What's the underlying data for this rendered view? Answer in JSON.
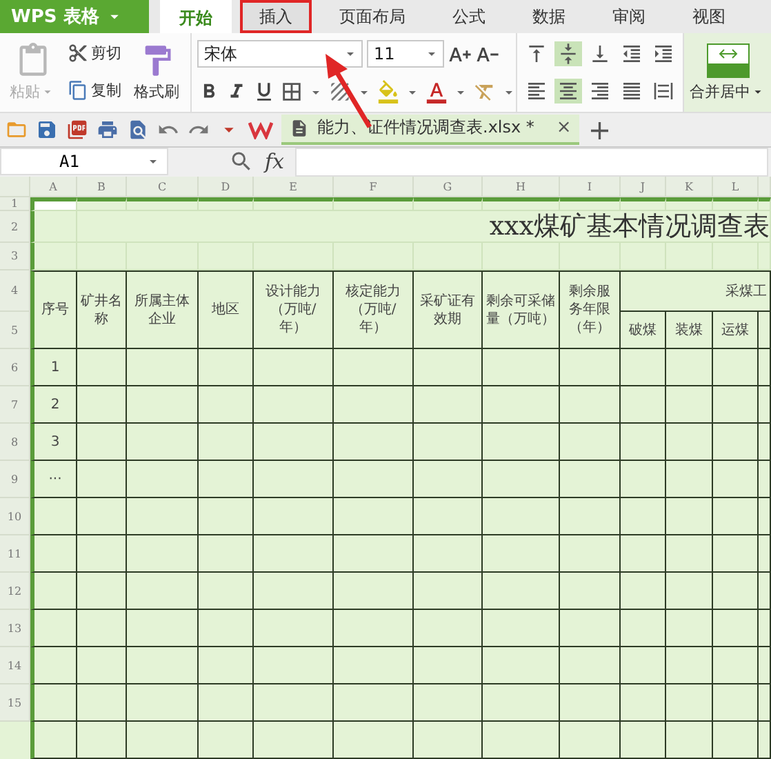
{
  "app": {
    "logo": "WPS 表格"
  },
  "tabs": [
    {
      "label": "开始",
      "selected": true,
      "highlighted": false
    },
    {
      "label": "插入",
      "selected": false,
      "highlighted": true
    },
    {
      "label": "页面布局",
      "selected": false,
      "highlighted": false
    },
    {
      "label": "公式",
      "selected": false,
      "highlighted": false
    },
    {
      "label": "数据",
      "selected": false,
      "highlighted": false
    },
    {
      "label": "审阅",
      "selected": false,
      "highlighted": false
    },
    {
      "label": "视图",
      "selected": false,
      "highlighted": false
    }
  ],
  "ribbon": {
    "paste": {
      "label": "粘贴",
      "disabled": true
    },
    "cut": "剪切",
    "copy": "复制",
    "format_painter": "格式刷",
    "font": {
      "name": "宋体",
      "size": "11"
    },
    "vertical_align": [
      {
        "kind": "top",
        "selected": false
      },
      {
        "kind": "middle",
        "selected": true
      },
      {
        "kind": "bottom",
        "selected": false
      },
      {
        "kind": "outdent",
        "selected": false
      },
      {
        "kind": "indent",
        "selected": false
      }
    ],
    "horizontal_align": [
      {
        "kind": "left",
        "selected": false
      },
      {
        "kind": "center",
        "selected": true
      },
      {
        "kind": "right",
        "selected": false
      },
      {
        "kind": "justify",
        "selected": false
      },
      {
        "kind": "distributed",
        "selected": false
      }
    ],
    "merge": "合并居中"
  },
  "document_tab": {
    "title": "能力、证件情况调查表.xlsx *",
    "close": "×",
    "add": "+"
  },
  "formula_bar": {
    "name_box": "A1",
    "function_label": "fx"
  },
  "sheet": {
    "columns": [
      "A",
      "B",
      "C",
      "D",
      "E",
      "F",
      "G",
      "H",
      "I",
      "J",
      "K",
      "L"
    ],
    "rows": [
      "1",
      "2",
      "3",
      "4",
      "5",
      "6",
      "7",
      "8",
      "9",
      "10",
      "11",
      "12",
      "13",
      "14",
      "15"
    ],
    "title": "xxx煤矿基本情况调查表",
    "headers": [
      "序号",
      "矿井名称",
      "所属主体企业",
      "地区",
      "设计能力（万吨/年）",
      "核定能力（万吨/年）",
      "采矿证有效期",
      "剩余可采储量（万吨）",
      "剩余服务年限（年）"
    ],
    "group_header": "采煤工",
    "sub_headers": [
      "破煤",
      "装煤",
      "运煤"
    ],
    "serials": [
      "1",
      "2",
      "3",
      "···"
    ]
  }
}
